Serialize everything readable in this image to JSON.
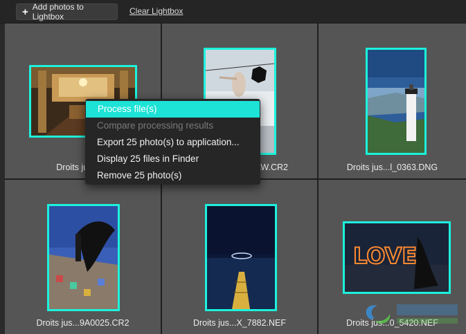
{
  "toolbar": {
    "add_label": "Add photos to Lightbox",
    "clear_label": "Clear Lightbox"
  },
  "photos": [
    {
      "caption": "Droits jusq...o",
      "icon": "opera-interior-photo"
    },
    {
      "caption": "AW.CR2",
      "icon": "figure-sculpture-photo"
    },
    {
      "caption": "Droits jus...l_0363.DNG",
      "icon": "lighthouse-photo"
    },
    {
      "caption": "Droits jus...9A0025.CR2",
      "icon": "woman-flowing-hair-photo"
    },
    {
      "caption": "Droits jus...X_7882.NEF",
      "icon": "pier-night-photo"
    },
    {
      "caption": "Droits jus...0_5420.NEF",
      "icon": "love-lights-photo"
    }
  ],
  "context_menu": {
    "items": [
      {
        "label": "Process file(s)",
        "state": "highlighted"
      },
      {
        "label": "Compare processing results",
        "state": "disabled"
      },
      {
        "label": "Export 25 photo(s) to application...",
        "state": "enabled"
      },
      {
        "label": "Display 25 files in Finder",
        "state": "enabled"
      },
      {
        "label": "Remove 25 photo(s)",
        "state": "enabled"
      }
    ]
  },
  "colors": {
    "selection_border": "#1cf2dc",
    "menu_highlight": "#1ce3d6",
    "cell_background": "#555555"
  }
}
